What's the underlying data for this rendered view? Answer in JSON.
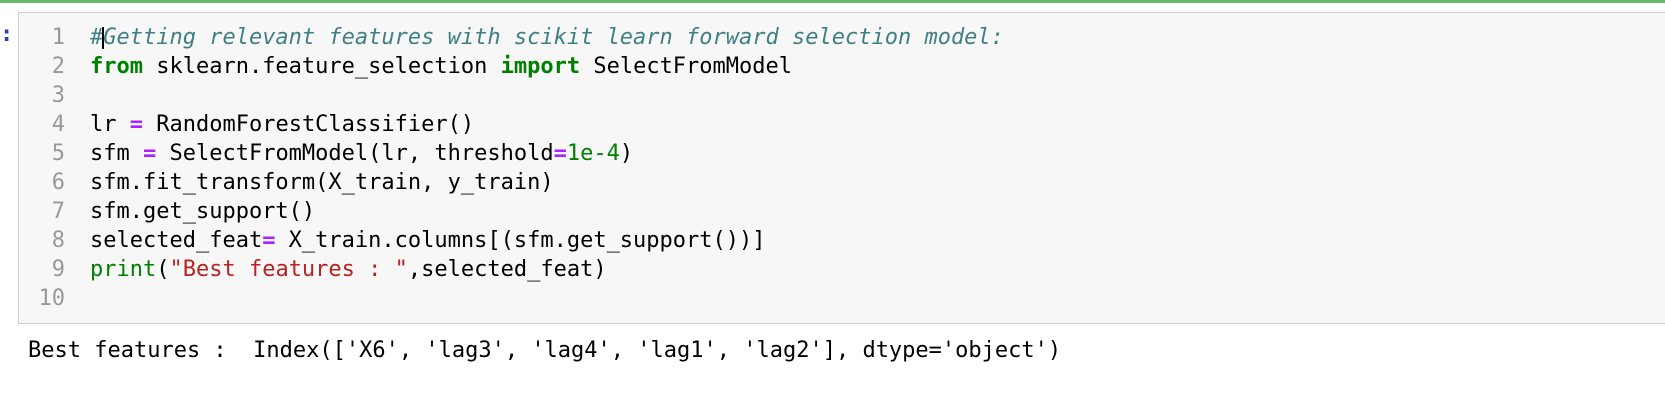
{
  "cell": {
    "prompt": ":",
    "lines": [
      {
        "num": "1",
        "parts": [
          [
            "cm",
            "#"
          ],
          [
            "cursor",
            ""
          ],
          [
            "cm",
            "Getting relevant features with scikit learn forward selection model:"
          ]
        ]
      },
      {
        "num": "2",
        "parts": [
          [
            "kw",
            "from"
          ],
          [
            "",
            " sklearn.feature_selection "
          ],
          [
            "kw",
            "import"
          ],
          [
            "",
            " SelectFromModel"
          ]
        ]
      },
      {
        "num": "3",
        "parts": []
      },
      {
        "num": "4",
        "parts": [
          [
            "",
            "lr "
          ],
          [
            "op",
            "="
          ],
          [
            "",
            " RandomForestClassifier()"
          ]
        ]
      },
      {
        "num": "5",
        "parts": [
          [
            "",
            "sfm "
          ],
          [
            "op",
            "="
          ],
          [
            "",
            " SelectFromModel(lr, threshold"
          ],
          [
            "op",
            "="
          ],
          [
            "num",
            "1e-4"
          ],
          [
            "",
            ")"
          ]
        ]
      },
      {
        "num": "6",
        "parts": [
          [
            "",
            "sfm.fit_transform(X_train, y_train)"
          ]
        ]
      },
      {
        "num": "7",
        "parts": [
          [
            "",
            "sfm.get_support()"
          ]
        ]
      },
      {
        "num": "8",
        "parts": [
          [
            "",
            "selected_feat"
          ],
          [
            "op",
            "="
          ],
          [
            "",
            " X_train.columns[(sfm.get_support())]"
          ]
        ]
      },
      {
        "num": "9",
        "parts": [
          [
            "bi",
            "print"
          ],
          [
            "",
            "("
          ],
          [
            "str",
            "\"Best features : \""
          ],
          [
            "",
            ",selected_feat)"
          ]
        ]
      },
      {
        "num": "10",
        "parts": []
      }
    ]
  },
  "output": {
    "text": "Best features :  Index(['X6', 'lag3', 'lag4', 'lag1', 'lag2'], dtype='object')"
  },
  "colors": {
    "accent_top_line": "#66bb6a",
    "prompt": "#303f9f",
    "comment": "#408080",
    "keyword": "#008000",
    "operator": "#aa22ff",
    "string": "#ba2121"
  }
}
